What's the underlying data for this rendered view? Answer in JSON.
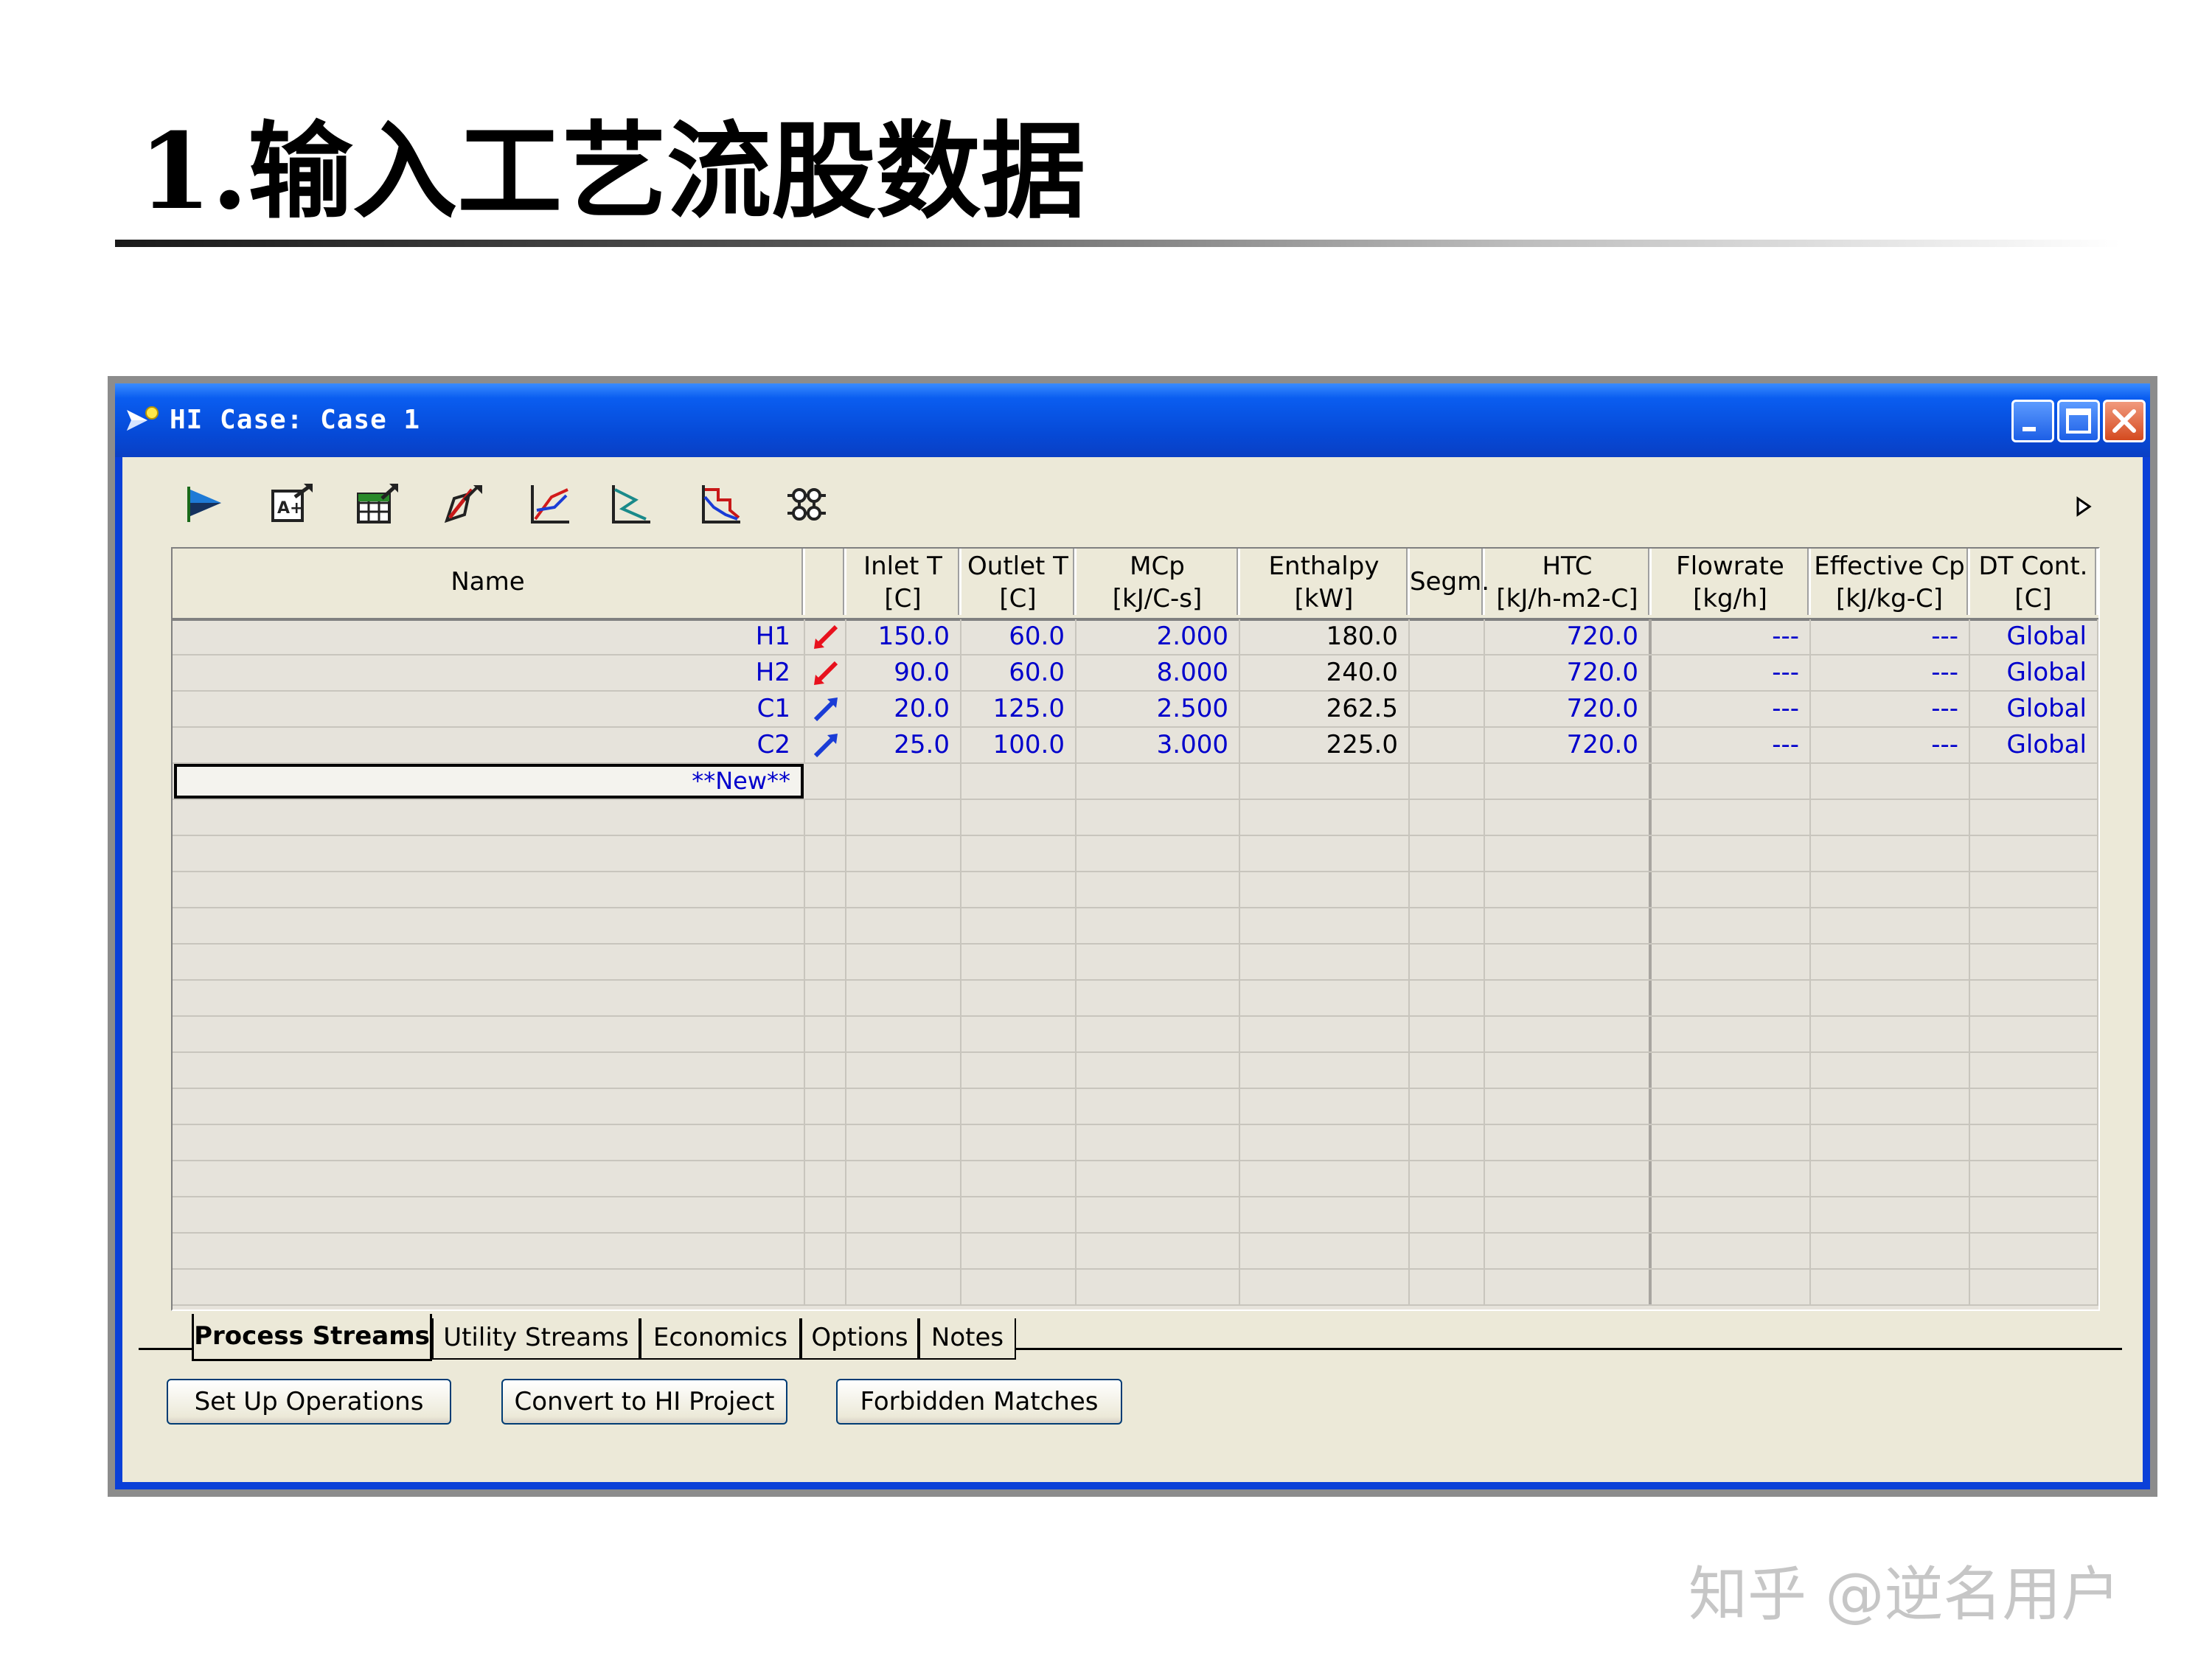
{
  "slide": {
    "title": "1.输入工艺流股数据",
    "watermark": "知乎 @逆名用户"
  },
  "window": {
    "title": "HI Case: Case 1"
  },
  "toolbar": {
    "icons": [
      "stream-wizard-icon",
      "import-data-icon",
      "data-table-icon",
      "edit-stream-icon",
      "composite-curve-icon",
      "grand-composite-icon",
      "balanced-curve-icon",
      "network-icon"
    ]
  },
  "table": {
    "columns": [
      {
        "label": "Name"
      },
      {
        "label": ""
      },
      {
        "label": "Inlet T\n[C]"
      },
      {
        "label": "Outlet T\n[C]"
      },
      {
        "label": "MCp\n[kJ/C-s]"
      },
      {
        "label": "Enthalpy\n[kW]"
      },
      {
        "label": "Segm."
      },
      {
        "label": "HTC\n[kJ/h-m2-C]"
      },
      {
        "label": "Flowrate\n[kg/h]"
      },
      {
        "label": "Effective Cp\n[kJ/kg-C]"
      },
      {
        "label": "DT Cont.\n[C]"
      }
    ],
    "rows": [
      {
        "name": "H1",
        "type": "hot",
        "inlet_t": "150.0",
        "outlet_t": "60.0",
        "mcp": "2.000",
        "enthalpy": "180.0",
        "segm": "",
        "htc": "720.0",
        "flowrate": "---",
        "effective_cp": "---",
        "dt_cont": "Global"
      },
      {
        "name": "H2",
        "type": "hot",
        "inlet_t": "90.0",
        "outlet_t": "60.0",
        "mcp": "8.000",
        "enthalpy": "240.0",
        "segm": "",
        "htc": "720.0",
        "flowrate": "---",
        "effective_cp": "---",
        "dt_cont": "Global"
      },
      {
        "name": "C1",
        "type": "cold",
        "inlet_t": "20.0",
        "outlet_t": "125.0",
        "mcp": "2.500",
        "enthalpy": "262.5",
        "segm": "",
        "htc": "720.0",
        "flowrate": "---",
        "effective_cp": "---",
        "dt_cont": "Global"
      },
      {
        "name": "C2",
        "type": "cold",
        "inlet_t": "25.0",
        "outlet_t": "100.0",
        "mcp": "3.000",
        "enthalpy": "225.0",
        "segm": "",
        "htc": "720.0",
        "flowrate": "---",
        "effective_cp": "---",
        "dt_cont": "Global"
      }
    ],
    "new_row_label": "**New**",
    "colors": {
      "hot": "#e8111d",
      "cold": "#1a3cd6"
    }
  },
  "tabs": [
    "Process Streams",
    "Utility Streams",
    "Economics",
    "Options",
    "Notes"
  ],
  "active_tab": "Process Streams",
  "buttons": {
    "setup_operations": "Set Up Operations",
    "convert": "Convert to HI Project",
    "forbidden_matches": "Forbidden Matches"
  }
}
